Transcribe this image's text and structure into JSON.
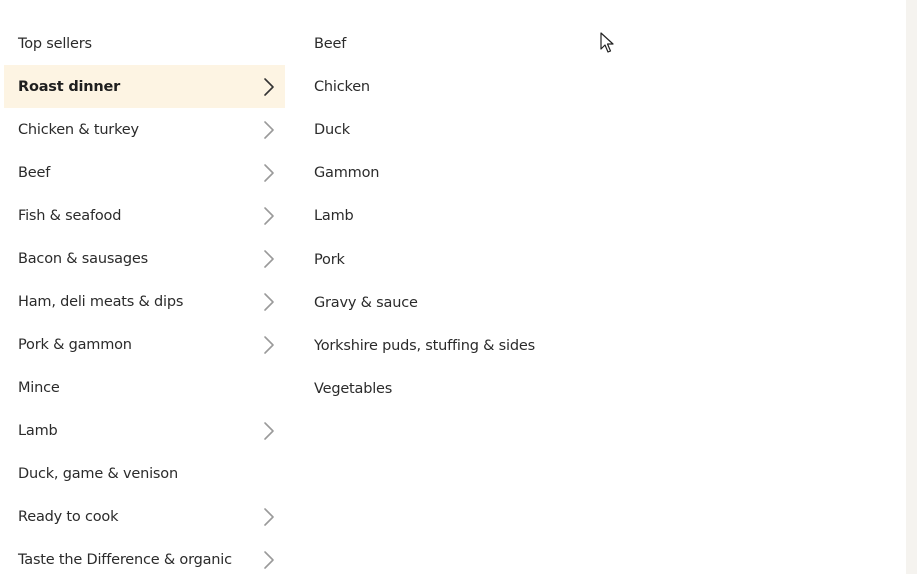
{
  "menu": {
    "categories": [
      {
        "label": "Top sellers",
        "has_chevron": false,
        "active": false
      },
      {
        "label": "Roast dinner",
        "has_chevron": true,
        "active": true
      },
      {
        "label": "Chicken & turkey",
        "has_chevron": true,
        "active": false
      },
      {
        "label": "Beef",
        "has_chevron": true,
        "active": false
      },
      {
        "label": "Fish & seafood",
        "has_chevron": true,
        "active": false
      },
      {
        "label": "Bacon & sausages",
        "has_chevron": true,
        "active": false
      },
      {
        "label": "Ham, deli meats & dips",
        "has_chevron": true,
        "active": false
      },
      {
        "label": "Pork & gammon",
        "has_chevron": true,
        "active": false
      },
      {
        "label": "Mince",
        "has_chevron": false,
        "active": false
      },
      {
        "label": "Lamb",
        "has_chevron": true,
        "active": false
      },
      {
        "label": "Duck, game & venison",
        "has_chevron": false,
        "active": false
      },
      {
        "label": "Ready to cook",
        "has_chevron": true,
        "active": false
      },
      {
        "label": "Taste the Difference & organic",
        "has_chevron": true,
        "active": false
      }
    ],
    "subcategories": [
      {
        "label": "Beef"
      },
      {
        "label": "Chicken"
      },
      {
        "label": "Duck"
      },
      {
        "label": "Gammon"
      },
      {
        "label": "Lamb"
      },
      {
        "label": "Pork"
      },
      {
        "label": "Gravy & sauce"
      },
      {
        "label": "Yorkshire puds, stuffing & sides"
      },
      {
        "label": "Vegetables"
      }
    ]
  },
  "icons": {
    "chevron": "chevron-right-icon",
    "cursor": "mouse-pointer-icon"
  },
  "colors": {
    "active_background": "#fdf4e3",
    "text": "#2b2b2b",
    "active_chevron": "#333333",
    "chevron": "#9a9a9a",
    "right_strip": "#f5f3ef"
  }
}
